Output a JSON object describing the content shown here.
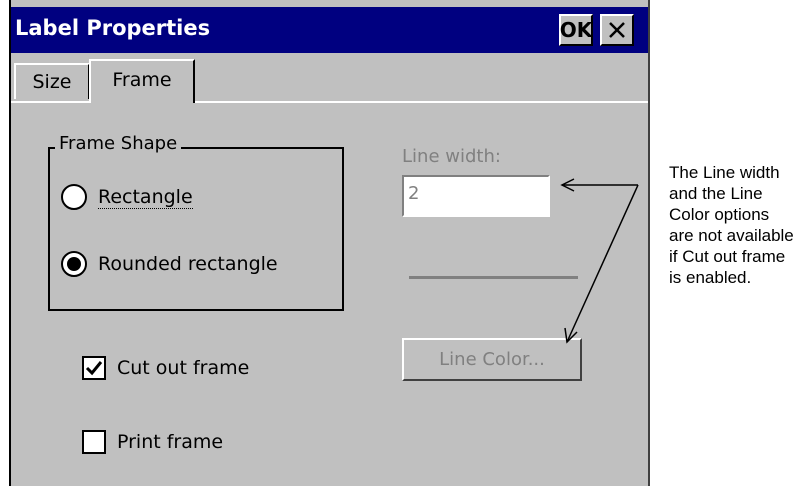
{
  "window": {
    "title": "Label Properties",
    "ok_label": "OK",
    "close_icon": "close-icon"
  },
  "tabs": [
    {
      "label": "Size",
      "selected": false
    },
    {
      "label": "Frame",
      "selected": true
    }
  ],
  "frame_shape": {
    "group_label": "Frame Shape",
    "options": [
      {
        "label": "Rectangle",
        "selected": false
      },
      {
        "label": "Rounded rectangle",
        "selected": true
      }
    ]
  },
  "checkboxes": {
    "cut_out_frame": {
      "label": "Cut out frame",
      "checked": true
    },
    "print_frame": {
      "label": "Print frame",
      "checked": false
    }
  },
  "line_width": {
    "label": "Line width:",
    "value": "2",
    "enabled": false
  },
  "line_color": {
    "button_label": "Line Color...",
    "enabled": false
  },
  "annotation": {
    "text": "The Line width and the Line Color options are not available if Cut out frame is enabled."
  },
  "colors": {
    "titlebar": "#000080",
    "dialog_bg": "#c0c0c0",
    "disabled_text": "#808080"
  }
}
